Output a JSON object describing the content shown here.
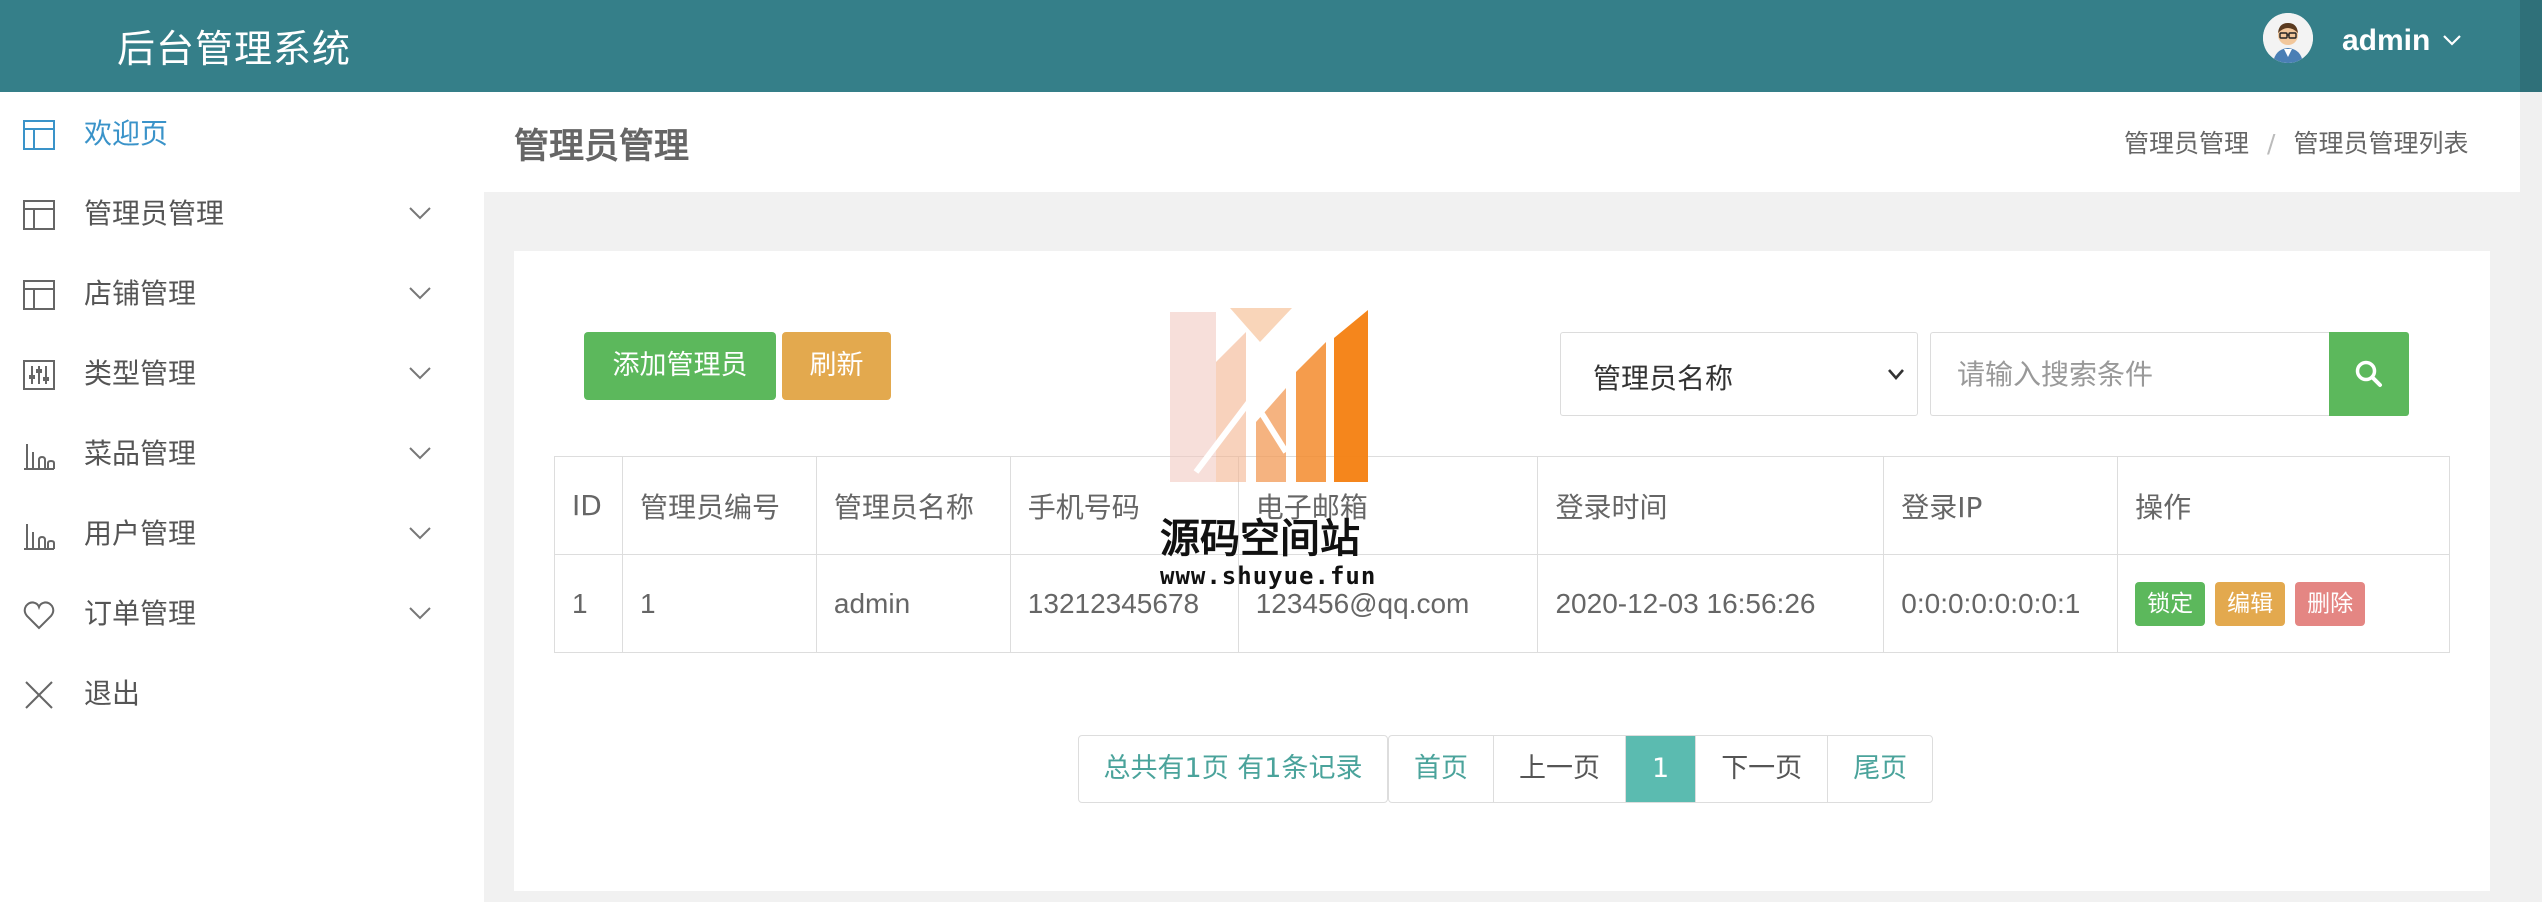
{
  "header": {
    "title": "后台管理系统",
    "user_name": "admin"
  },
  "sidebar": {
    "items": [
      {
        "label": "欢迎页",
        "icon": "layout-icon",
        "active": true,
        "expandable": false
      },
      {
        "label": "管理员管理",
        "icon": "layout-icon",
        "active": false,
        "expandable": true
      },
      {
        "label": "店铺管理",
        "icon": "layout-icon",
        "active": false,
        "expandable": true
      },
      {
        "label": "类型管理",
        "icon": "sliders-icon",
        "active": false,
        "expandable": true
      },
      {
        "label": "菜品管理",
        "icon": "bar-chart-icon",
        "active": false,
        "expandable": true
      },
      {
        "label": "用户管理",
        "icon": "bar-chart-icon",
        "active": false,
        "expandable": true
      },
      {
        "label": "订单管理",
        "icon": "heart-icon",
        "active": false,
        "expandable": true
      },
      {
        "label": "退出",
        "icon": "close-icon",
        "active": false,
        "expandable": false
      }
    ]
  },
  "page": {
    "title": "管理员管理",
    "breadcrumb": [
      "管理员管理",
      "管理员管理列表"
    ]
  },
  "toolbar": {
    "add_label": "添加管理员",
    "refresh_label": "刷新",
    "search_field_selected": "管理员名称",
    "search_placeholder": "请输入搜索条件"
  },
  "table": {
    "headers": [
      "ID",
      "管理员编号",
      "管理员名称",
      "手机号码",
      "电子邮箱",
      "登录时间",
      "登录IP",
      "操作"
    ],
    "rows": [
      {
        "id": "1",
        "number": "1",
        "name": "admin",
        "phone": "13212345678",
        "email": "123456@qq.com",
        "login_time": "2020-12-03 16:56:26",
        "login_ip": "0:0:0:0:0:0:0:1",
        "actions": [
          "锁定",
          "编辑",
          "删除"
        ]
      }
    ]
  },
  "pagination": {
    "summary": "总共有1页  有1条记录",
    "first": "首页",
    "prev": "上一页",
    "current": "1",
    "next": "下一页",
    "last": "尾页"
  },
  "watermark": {
    "text": "源码空间站",
    "url": "www.shuyue.fun"
  },
  "colors": {
    "header_bg": "#357f89",
    "accent_green": "#5cb85c",
    "accent_orange": "#e3a94e",
    "accent_red": "#d9534f",
    "active_blue": "#3a93c9",
    "pager_teal": "#5bbbb0"
  }
}
